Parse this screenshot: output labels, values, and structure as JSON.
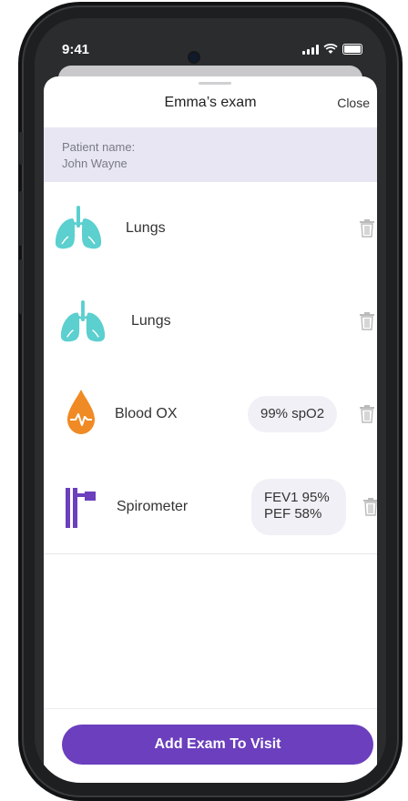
{
  "status": {
    "time": "9:41"
  },
  "sheet": {
    "title": "Emma’s exam",
    "close_label": "Close"
  },
  "patient": {
    "label": "Patient name:",
    "name": "John Wayne"
  },
  "items": [
    {
      "label": "Lungs",
      "icon": "lungs-icon"
    },
    {
      "label": "Lungs",
      "icon": "lungs-icon"
    },
    {
      "label": "Blood OX",
      "icon": "blood-drop-icon",
      "value": "99% spO2"
    },
    {
      "label": "Spirometer",
      "icon": "spirometer-icon",
      "value_line1": "FEV1 95%",
      "value_line2": "PEF 58%"
    }
  ],
  "footer": {
    "button_label": "Add Exam To Visit"
  },
  "colors": {
    "accent": "#6b3fbd",
    "lungs": "#5ccfcf",
    "blood": "#f08a24",
    "spirometer": "#6b3fbd",
    "patient_bg": "#e7e6f2"
  }
}
